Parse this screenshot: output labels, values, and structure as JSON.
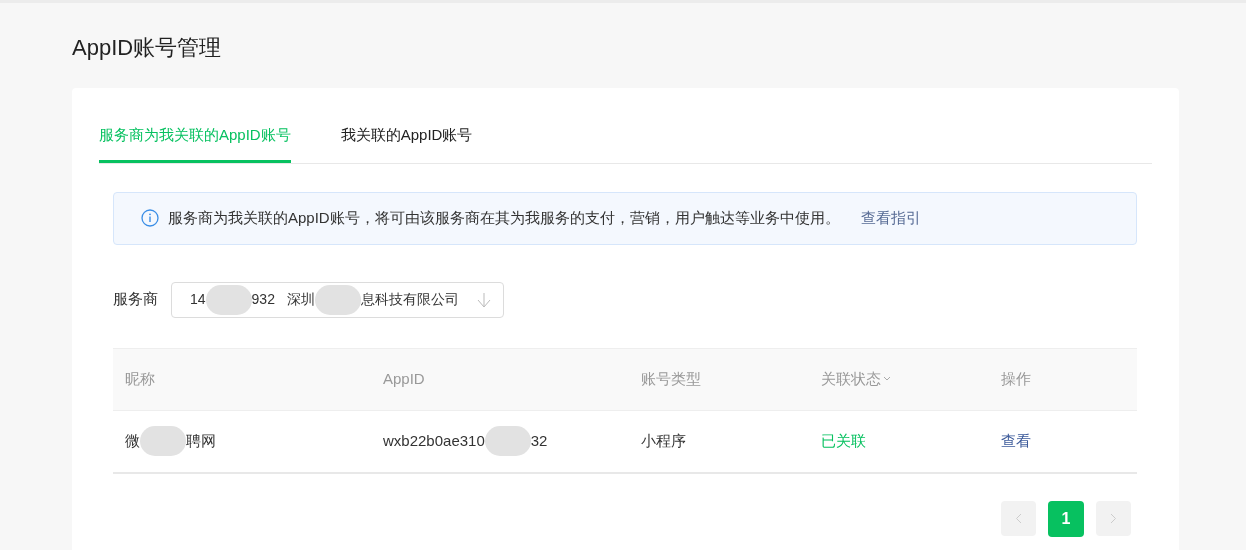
{
  "page_title": "AppID账号管理",
  "tabs": [
    {
      "label": "服务商为我关联的AppID账号",
      "selected": true
    },
    {
      "label": "我关联的AppID账号",
      "selected": false
    }
  ],
  "notice": {
    "text": "服务商为我关联的AppID账号，将可由该服务商在其为我服务的支付，营销，用户触达等业务中使用。",
    "link": "查看指引"
  },
  "filter": {
    "label": "服务商",
    "value_parts": [
      "14",
      "932   深圳",
      "息科技有限公司"
    ]
  },
  "table": {
    "columns": [
      {
        "label": "昵称",
        "sortable": false
      },
      {
        "label": "AppID",
        "sortable": false
      },
      {
        "label": "账号类型",
        "sortable": false
      },
      {
        "label": "关联状态",
        "sortable": true
      },
      {
        "label": "操作",
        "sortable": false
      }
    ],
    "rows": [
      {
        "nickname_parts": [
          "微",
          "聘网"
        ],
        "appid_parts": [
          "wxb22b0ae310",
          "32"
        ],
        "type": "小程序",
        "status": "已关联",
        "linked": true,
        "action": "查看"
      }
    ]
  },
  "pagination": {
    "pages": [
      {
        "label": "1",
        "selected": true
      }
    ]
  }
}
